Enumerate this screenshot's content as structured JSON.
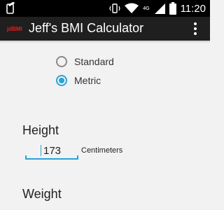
{
  "status_bar": {
    "time": "11:20",
    "network": "4G",
    "icons": [
      "phone-icon",
      "vibrate-icon",
      "wifi-icon",
      "cellular-signal-icon",
      "battery-icon"
    ]
  },
  "app_bar": {
    "logo_text": "jdBMI",
    "title": "Jeff's BMI Calculator",
    "menu_icon": "overflow-menu-icon"
  },
  "units": {
    "options": [
      {
        "label": "Standard",
        "selected": false
      },
      {
        "label": "Metric",
        "selected": true
      }
    ]
  },
  "height": {
    "title": "Height",
    "value": "173",
    "unit": "Centimeters"
  },
  "weight": {
    "title": "Weight"
  },
  "colors": {
    "accent": "#2aa3d8",
    "action_bar": "#1f1f1f",
    "logo": "#e02020"
  }
}
